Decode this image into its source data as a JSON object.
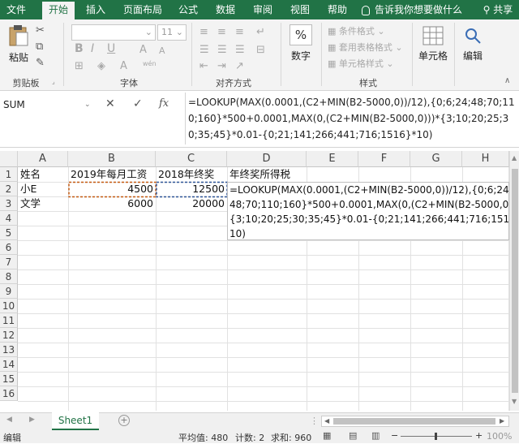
{
  "tabs": [
    {
      "label": "文件",
      "active": false
    },
    {
      "label": "开始",
      "active": true
    },
    {
      "label": "插入",
      "active": false
    },
    {
      "label": "页面布局",
      "active": false
    },
    {
      "label": "公式",
      "active": false
    },
    {
      "label": "数据",
      "active": false
    },
    {
      "label": "审阅",
      "active": false
    },
    {
      "label": "视图",
      "active": false
    },
    {
      "label": "帮助",
      "active": false
    }
  ],
  "tell_me": "告诉我你想要做什么",
  "share": "共享",
  "ribbon": {
    "paste": "粘贴",
    "clipboard": "剪贴板",
    "font": "字体",
    "font_size": "11",
    "bold": "B",
    "italic": "I",
    "underline": "U",
    "font_grow": "A",
    "font_shrink": "A",
    "wen": "wén",
    "alignment": "对齐方式",
    "number": "数字",
    "percent": "%",
    "cond_format": "条件格式",
    "table_format": "套用表格格式",
    "cell_style": "单元格样式",
    "styles": "样式",
    "cells": "单元格",
    "editing": "编辑"
  },
  "formula_bar": {
    "name_box": "SUM",
    "cancel": "✕",
    "enter": "✓",
    "fx": "fx",
    "formula": "=LOOKUP(MAX(0.0001,(C2+MIN(B2-5000,0))/12),{0;6;24;48;70;110;160}*500+0.0001,MAX(0,(C2+MIN(B2-5000,0)))*{3;10;20;25;30;35;45}*0.01-{0;21;141;266;441;716;1516}*10)"
  },
  "columns": [
    "A",
    "B",
    "C",
    "D",
    "E",
    "F",
    "G",
    "H"
  ],
  "rows": [
    "1",
    "2",
    "3",
    "4",
    "5",
    "6",
    "7",
    "8",
    "9",
    "10",
    "11",
    "12",
    "13",
    "14",
    "15",
    "16"
  ],
  "cells": {
    "A1": "姓名",
    "B1": "2019年每月工资",
    "C1": "2018年终奖",
    "D1": "年终奖所得税",
    "A2": "小E",
    "B2": "4500",
    "C2": "12500",
    "A3": "文学",
    "B3": "6000",
    "C3": "20000",
    "D2_line1": "=LOOKUP(MAX(0.0001,(C2+MIN(B2-5000,0))/12),{0;6;24;",
    "D2_line2": "48;70;110;160}*500+0.0001,MAX(0,(C2+MIN(B2-5000,0)))*",
    "D2_line3": "{3;10;20;25;30;35;45}*0.01-{0;21;141;266;441;716;1516}*",
    "D2_line4": "10)"
  },
  "sheet_tab": "Sheet1",
  "status": {
    "mode": "编辑",
    "average": "平均值: 480",
    "count": "计数: 2",
    "sum": "求和: 960",
    "zoom": "100%"
  },
  "colors": {
    "excel_green": "#217346",
    "selection_blue": "#4472c4",
    "formula_c2": "#2f5597",
    "formula_b2": "#c55a11"
  }
}
